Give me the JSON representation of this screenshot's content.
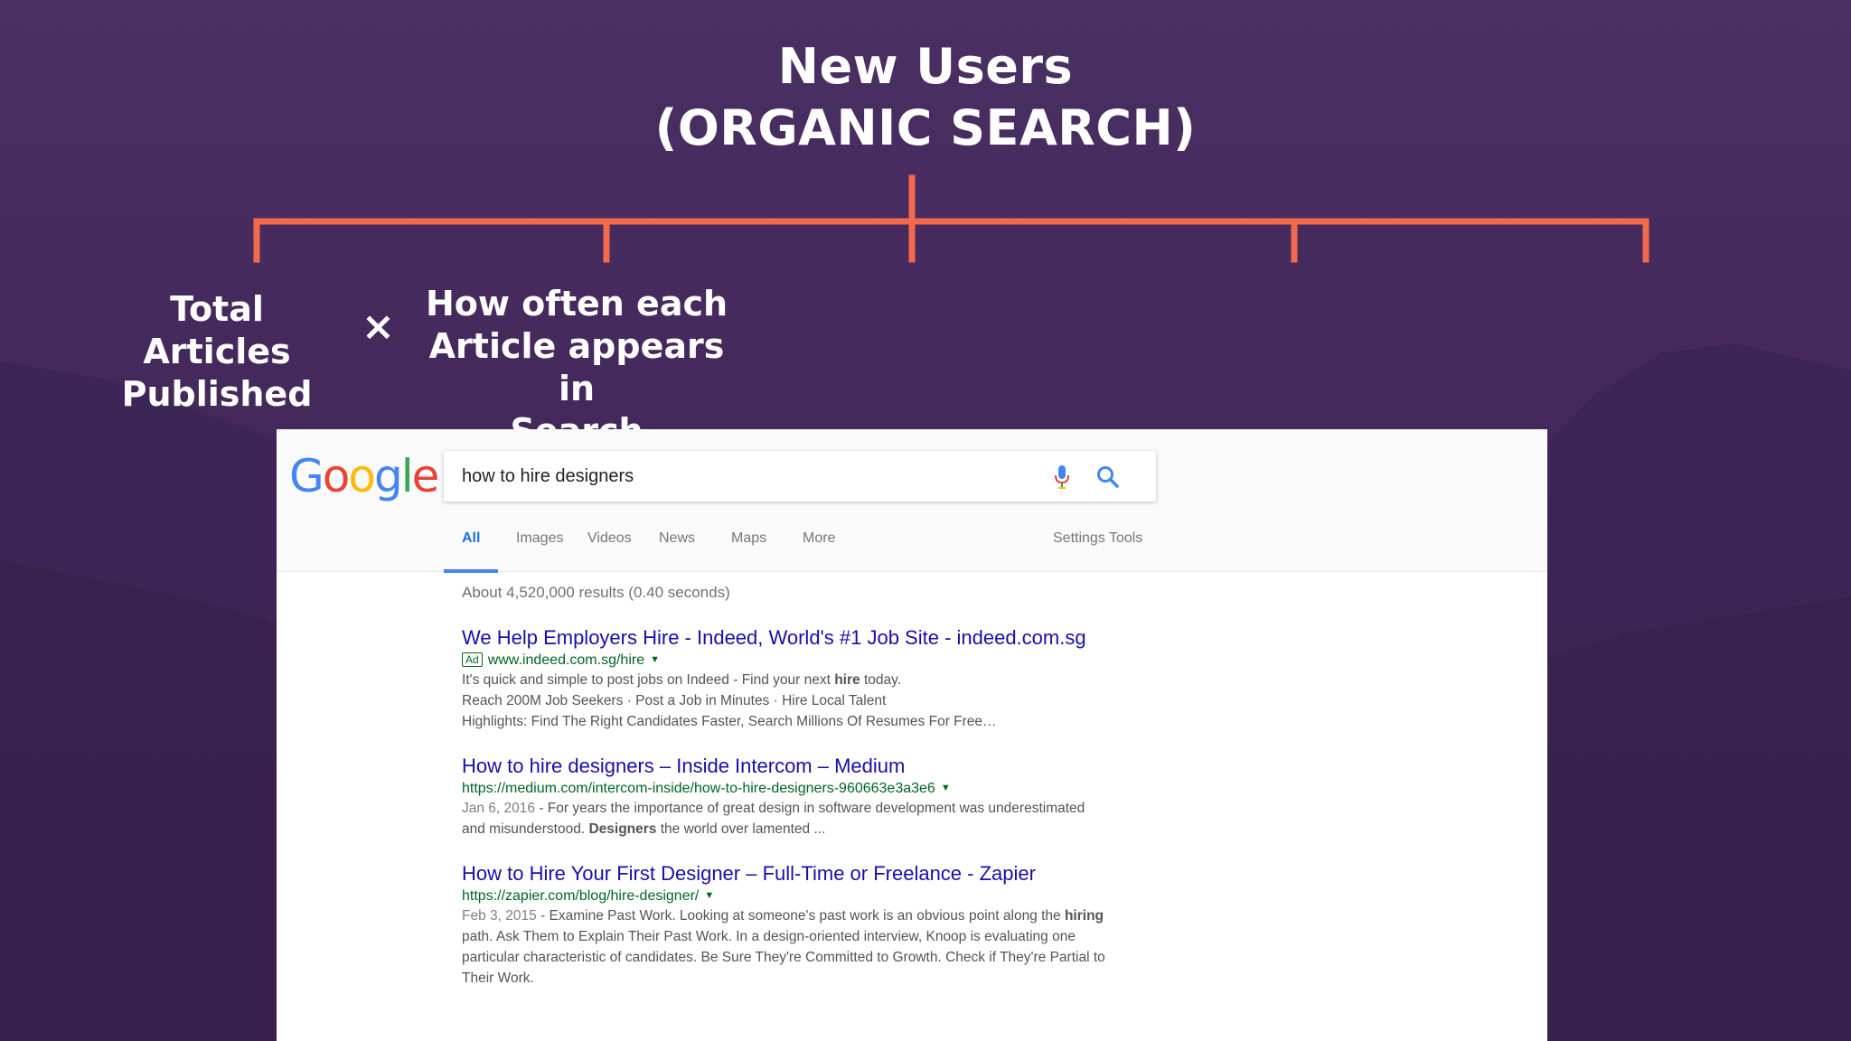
{
  "heading": {
    "line1": "New Users",
    "line2": "(ORGANIC SEARCH)"
  },
  "colors": {
    "bracket": "#f26a4b",
    "background": "#45295c",
    "title_link": "#1a0dab",
    "url_green": "#006621"
  },
  "factors": [
    {
      "line1": "Total Articles",
      "line2": "Published"
    },
    {
      "line1": "How often each",
      "line2": "Article appears in",
      "line3": "Search"
    }
  ],
  "operator": "×",
  "serp": {
    "logo": {
      "G": "G",
      "o1": "o",
      "o2": "o",
      "g": "g",
      "l": "l",
      "e": "e"
    },
    "logo_colors": [
      "#4285f4",
      "#ea4335",
      "#fbbc05",
      "#4285f4",
      "#34a853",
      "#ea4335"
    ],
    "query": "how to hire designers",
    "icons": [
      "mic-icon",
      "search-icon"
    ],
    "tabs": [
      {
        "label": "All",
        "active": true
      },
      {
        "label": "Images"
      },
      {
        "label": "Videos"
      },
      {
        "label": "News"
      },
      {
        "label": "Maps"
      },
      {
        "label": "More"
      },
      {
        "label": "Settings"
      },
      {
        "label": "Tools"
      }
    ],
    "stats": "About 4,520,000 results (0.40 seconds)",
    "results": [
      {
        "title": "We Help Employers Hire - Indeed, World's #1 Job Site - indeed.com.sg",
        "ad": "Ad",
        "url": "www.indeed.com.sg/hire",
        "snippet": {
          "l1a": "It's quick and simple to post jobs on Indeed - Find your next ",
          "l1b": "hire",
          "l1c": " today.",
          "l2": "Reach 200M Job Seekers · Post a Job in Minutes · Hire Local Talent",
          "l3": "Highlights: Find The Right Candidates Faster, Search Millions Of Resumes For Free…"
        }
      },
      {
        "title": "How to hire designers – Inside Intercom – Medium",
        "url": "https://medium.com/intercom-inside/how-to-hire-designers-960663e3a3e6",
        "date": "Jan 6, 2016",
        "snippet": {
          "l1": " - For years the importance of great design in software development was underestimated",
          "l2a": "and misunderstood. ",
          "l2b": "Designers",
          "l2c": " the world over lamented ..."
        }
      },
      {
        "title": "How to Hire Your First Designer – Full-Time or Freelance - Zapier",
        "url": "https://zapier.com/blog/hire-designer/",
        "date": "Feb 3, 2015",
        "snippet": {
          "l1a": " - Examine Past Work. Looking at someone's past work is an obvious point along the ",
          "l1b": "hiring",
          "l2": "path. Ask Them to Explain Their Past Work. In a design-oriented interview, Knoop is evaluating one",
          "l3": "particular characteristic of candidates. Be Sure They're Committed to Growth. Check if They're Partial to",
          "l4": "Their Work."
        }
      }
    ]
  }
}
